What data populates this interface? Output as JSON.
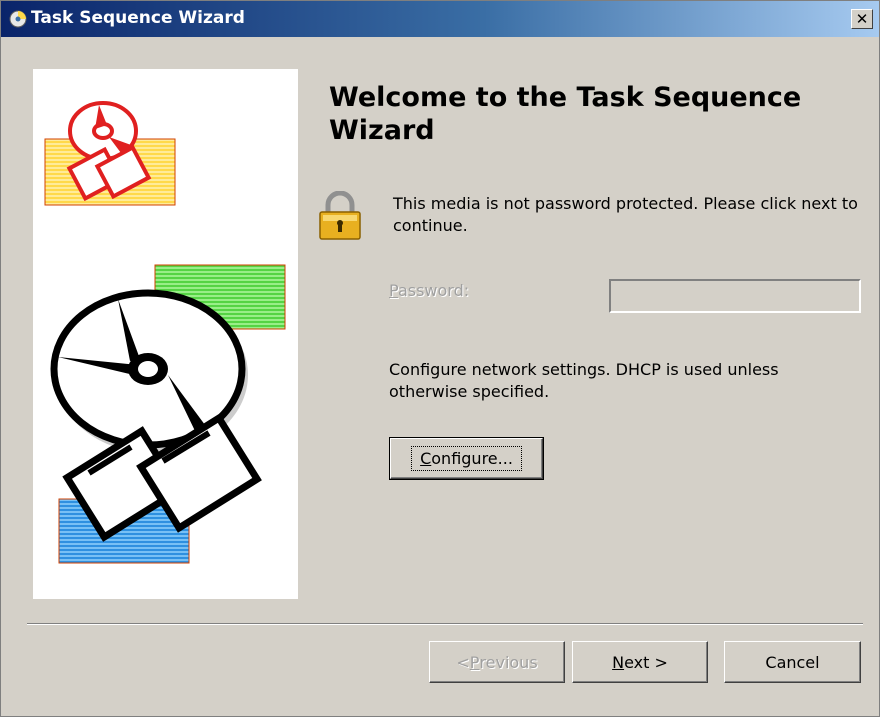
{
  "window": {
    "title": "Task Sequence Wizard",
    "title_icon": "wizard-cd-icon",
    "close_glyph": "✕"
  },
  "main": {
    "heading": "Welcome to the Task Sequence Wizard",
    "lock_icon": "padlock-icon",
    "password_message": "This media is not password protected.  Please click next to continue.",
    "password": {
      "label_prefix": "",
      "label_accel": "P",
      "label_rest": "assword:",
      "value": ""
    },
    "network_message": "Configure network settings. DHCP is used unless otherwise specified.",
    "configure_button": {
      "accel": "C",
      "rest": "onfigure..."
    }
  },
  "footer": {
    "previous": {
      "prefix": "< ",
      "accel": "P",
      "rest": "revious"
    },
    "next": {
      "accel": "N",
      "rest": "ext >"
    },
    "cancel_label": "Cancel"
  },
  "colors": {
    "dialog_bg": "#d4d0c8",
    "title_start": "#0a246a",
    "title_end": "#a6caf0",
    "illus_yellow": "#ffd94a",
    "illus_green": "#66dd55",
    "illus_blue": "#3aa0ee",
    "illus_red": "#e02020",
    "lock_gold": "#e8b020"
  }
}
